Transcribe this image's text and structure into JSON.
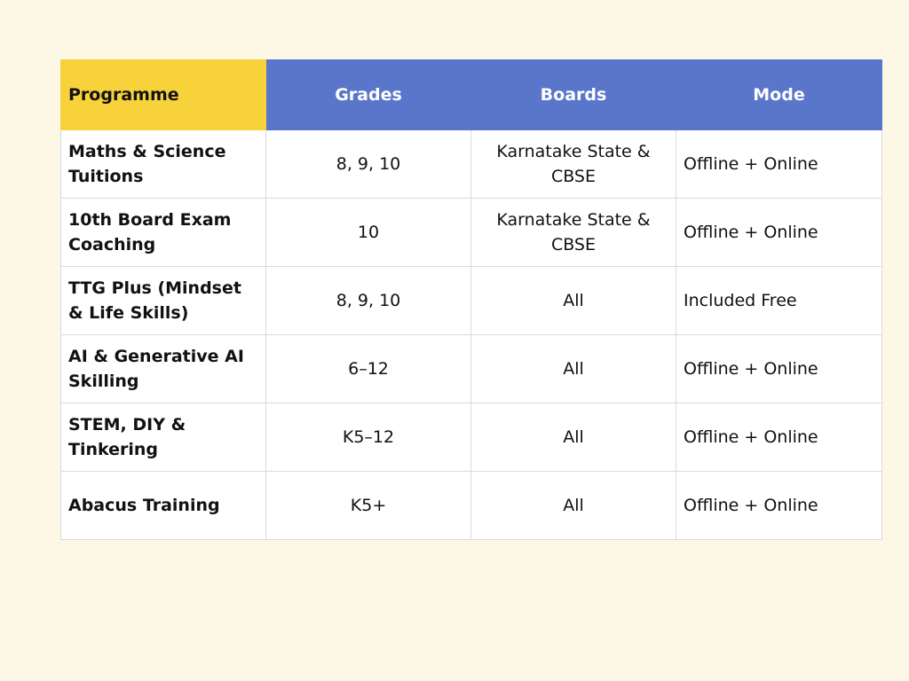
{
  "table": {
    "headers": [
      "Programme",
      "Grades",
      "Boards",
      "Mode"
    ],
    "rows": [
      {
        "programme": "Maths & Science Tuitions",
        "grades": "8, 9, 10",
        "boards": "Karnatake State & CBSE",
        "mode": "Offline + Online"
      },
      {
        "programme": "10th Board Exam Coaching",
        "grades": "10",
        "boards": "Karnatake State & CBSE",
        "mode": "Offline + Online"
      },
      {
        "programme": "TTG Plus (Mindset & Life Skills)",
        "grades": "8, 9, 10",
        "boards": "All",
        "mode": "Included Free"
      },
      {
        "programme": "AI & Generative AI Skilling",
        "grades": "6–12",
        "boards": "All",
        "mode": "Offline + Online"
      },
      {
        "programme": "STEM, DIY & Tinkering",
        "grades": "K5–12",
        "boards": "All",
        "mode": "Offline + Online"
      },
      {
        "programme": "Abacus Training",
        "grades": "K5+",
        "boards": "All",
        "mode": "Offline + Online"
      }
    ]
  },
  "colors": {
    "page_background": "#fdf7e6",
    "first_header": "#f8d23a",
    "header": "#5a76ca"
  }
}
